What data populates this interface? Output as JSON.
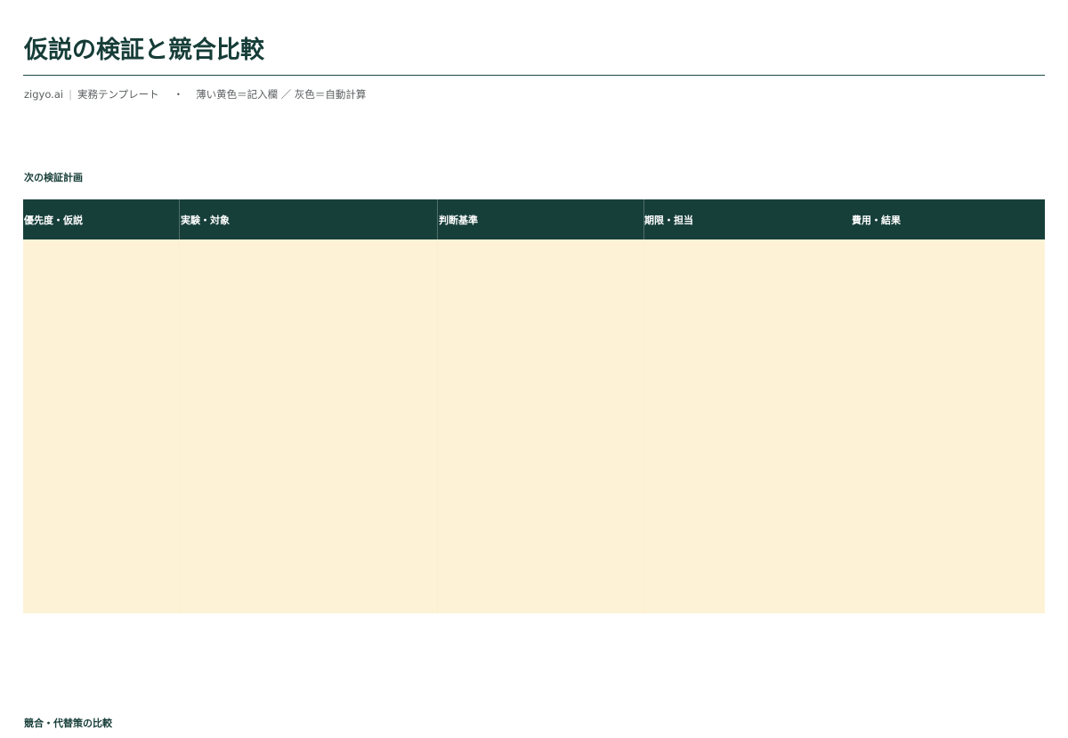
{
  "page": {
    "title": "仮説の検証と競合比較",
    "subtitle": {
      "brand": "zigyo.ai",
      "separator": "|",
      "label": "実務テンプレート",
      "dot": "・",
      "legend": "薄い黄色＝記入欄 ／ 灰色＝自動計算"
    }
  },
  "sections": {
    "plan": {
      "heading": "次の検証計画",
      "columns": [
        "優先度・仮説",
        "実験・対象",
        "判断基準",
        "期限・担当",
        "費用・結果"
      ],
      "rows": []
    },
    "comparison": {
      "heading": "競合・代替策の比較"
    }
  },
  "colors": {
    "primary": "#173f3a",
    "input_fill": "#fdf2d6",
    "muted_text": "#5b5f60"
  }
}
